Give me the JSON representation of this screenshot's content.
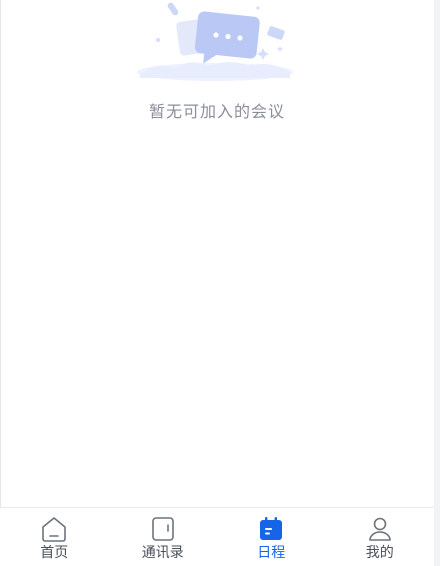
{
  "empty_state": {
    "message": "暂无可加入的会议"
  },
  "tabbar": {
    "active_index": 2,
    "tabs": [
      {
        "label": "首页",
        "icon": "home-icon"
      },
      {
        "label": "通讯录",
        "icon": "contacts-icon"
      },
      {
        "label": "日程",
        "icon": "calendar-icon"
      },
      {
        "label": "我的",
        "icon": "profile-icon"
      }
    ]
  },
  "colors": {
    "accent": "#1565e6",
    "tab_text": "#4a4f58",
    "empty_text": "#8a8f99",
    "illustration": "#b9c8f5"
  }
}
